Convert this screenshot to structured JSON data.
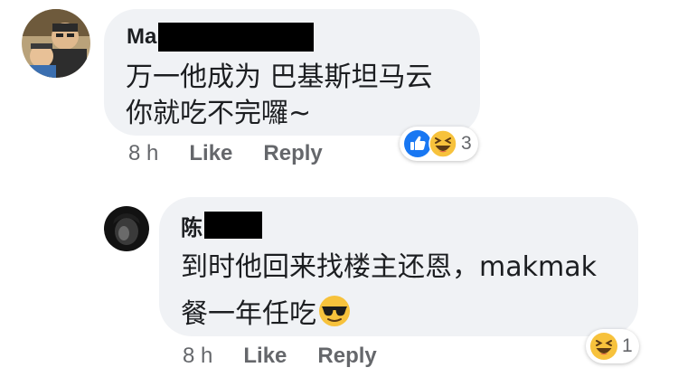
{
  "comment1": {
    "author_visible": "Ma",
    "lines": [
      "万一他成为 巴基斯坦马云",
      "你就吃不完囉~"
    ],
    "time": "8 h",
    "like_label": "Like",
    "reply_label": "Reply",
    "reactions": {
      "icons": [
        "like-icon",
        "laugh-icon"
      ],
      "count": "3"
    }
  },
  "comment2": {
    "author_visible": "陈",
    "lines": [
      "到时他回来找楼主还恩，makmak",
      "餐一年任吃"
    ],
    "emoji": "sunglasses-emoji",
    "time": "8 h",
    "like_label": "Like",
    "reply_label": "Reply",
    "reactions": {
      "icons": [
        "laugh-icon"
      ],
      "count": "1"
    }
  },
  "colors": {
    "bubble": "#f0f2f5",
    "secondary_text": "#65676b",
    "like_blue": "#1877f2",
    "emoji_yellow": "#f7c23c"
  }
}
